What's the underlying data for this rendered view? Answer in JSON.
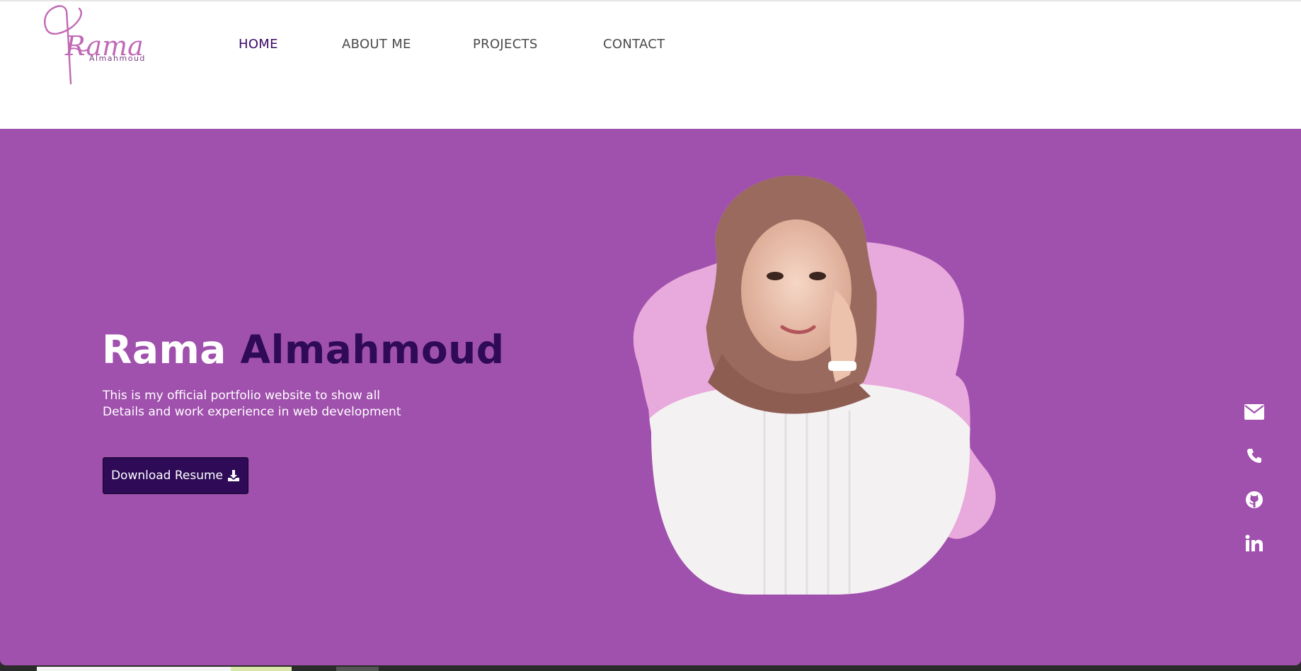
{
  "logo": {
    "script_text": "Rama",
    "sub_text": "Almahmoud",
    "color": "#c069b6"
  },
  "nav": {
    "items": [
      {
        "label": "HOME",
        "active": true
      },
      {
        "label": "ABOUT ME",
        "active": false
      },
      {
        "label": "PROJECTS",
        "active": false
      },
      {
        "label": "CONTACT",
        "active": false
      }
    ]
  },
  "hero": {
    "first_name": "Rama",
    "last_name": "Almahmoud",
    "description_lines": [
      "This is my official portfolio website to show all",
      "Details and work experience in web development"
    ],
    "button_label": "Download Resume",
    "button_icon": "download-icon"
  },
  "social": [
    {
      "icon": "envelope-icon"
    },
    {
      "icon": "phone-icon"
    },
    {
      "icon": "github-icon"
    },
    {
      "icon": "linkedin-icon"
    }
  ],
  "colors": {
    "hero_bg": "#a050ad",
    "accent_dark": "#2e0a57",
    "blob_pink": "#e8a9dc",
    "nav_text": "#4a4a4a"
  }
}
